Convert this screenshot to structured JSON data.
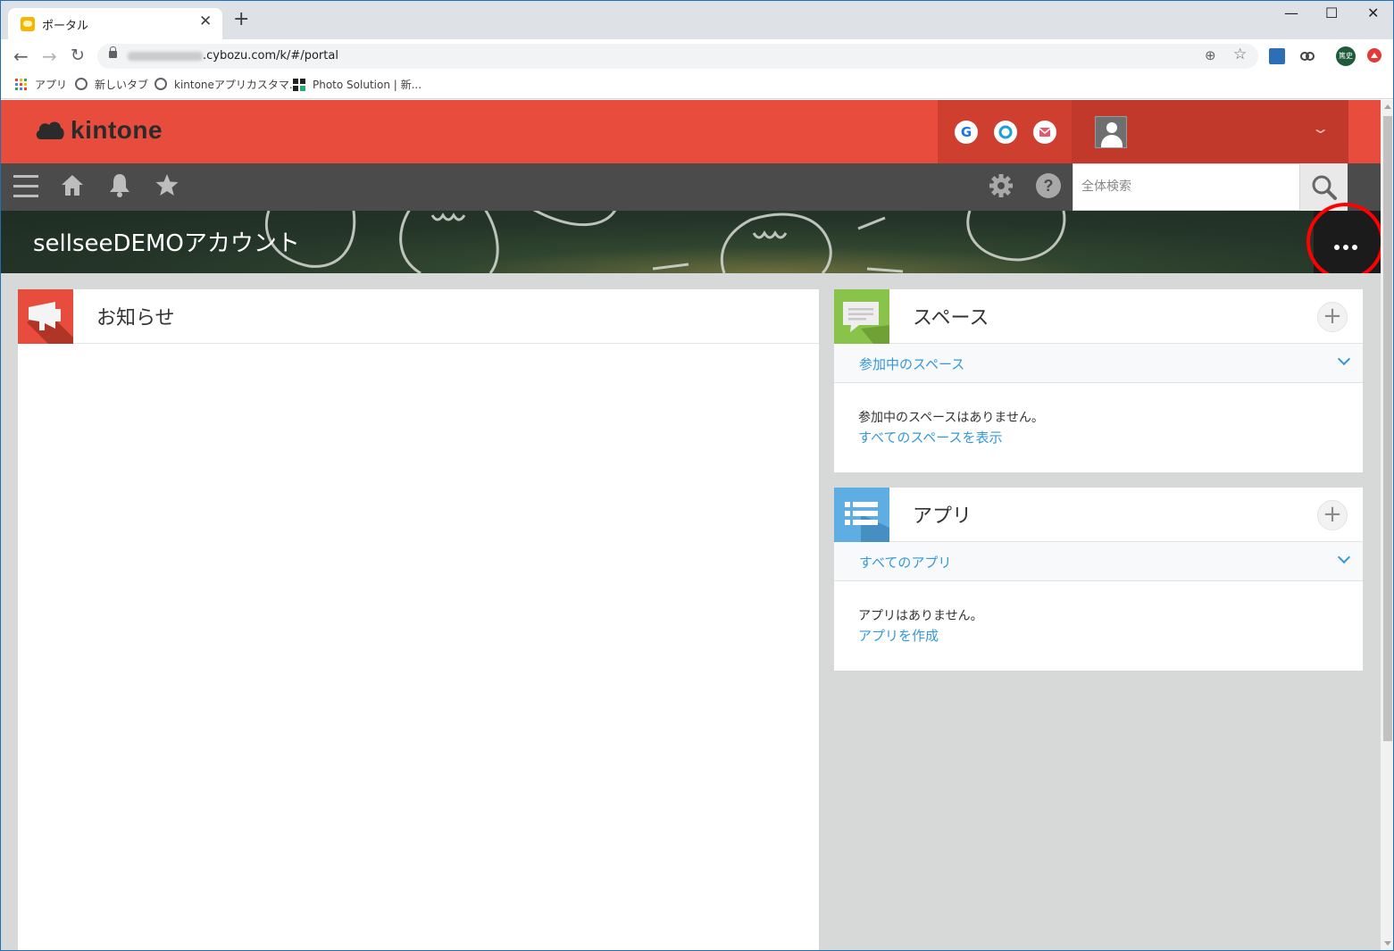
{
  "browser": {
    "tab_title": "ポータル",
    "tab_close": "✕",
    "new_tab": "+",
    "url_visible": ".cybozu.com/k/#/portal",
    "window_controls": {
      "minimize": "—",
      "maximize": "☐",
      "close": "✕"
    },
    "avatar_text": "篤史",
    "bookmarks": [
      {
        "label": "アプリ",
        "icon": "apps-grid-icon"
      },
      {
        "label": "新しいタブ",
        "icon": "globe-icon"
      },
      {
        "label": "kintoneアプリカスタマ...",
        "icon": "globe-icon"
      },
      {
        "label": "Photo Solution | 新...",
        "icon": "photo-solution-icon"
      }
    ]
  },
  "kintone": {
    "logo_text": "kintone",
    "brand_color": "#e74c3c",
    "services": [
      {
        "name": "garoon",
        "glyph": "G",
        "color": "#1a73e8"
      },
      {
        "name": "office",
        "glyph": "O",
        "color": "#1e9ee0"
      },
      {
        "name": "mailwise",
        "glyph": "✉",
        "color": "#e8566b"
      }
    ],
    "search_placeholder": "全体検索",
    "space_title": "sellseeDEMOアカウント",
    "notice": {
      "title": "お知らせ"
    },
    "spaces": {
      "title": "スペース",
      "add_label": "+",
      "filter_label": "参加中のスペース",
      "empty_message": "参加中のスペースはありません。",
      "link": "すべてのスペースを表示",
      "accent_color": "#8ac34a"
    },
    "apps": {
      "title": "アプリ",
      "add_label": "+",
      "filter_label": "すべてのアプリ",
      "empty_message": "アプリはありません。",
      "link": "アプリを作成",
      "accent_color": "#5faee3"
    }
  }
}
